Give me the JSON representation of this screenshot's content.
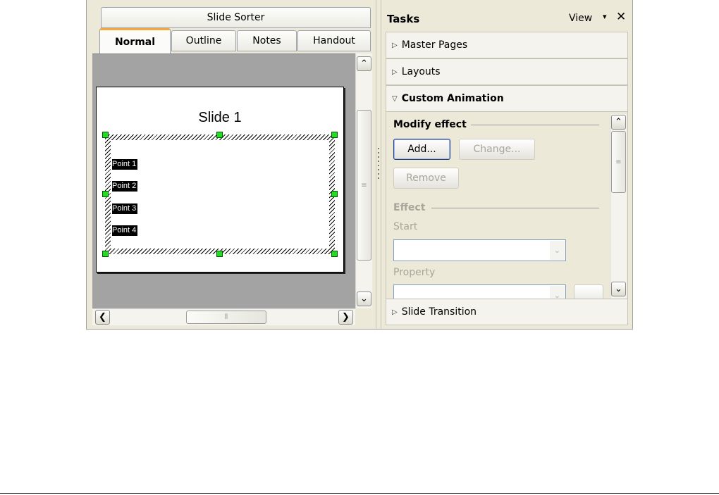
{
  "view_tabs": {
    "slide_sorter": "Slide Sorter",
    "normal": "Normal",
    "outline": "Outline",
    "notes": "Notes",
    "handout": "Handout"
  },
  "slide": {
    "title": "Slide 1",
    "bullets": [
      "Point 1",
      "Point 2",
      "Point 3",
      "Point 4"
    ]
  },
  "task_pane": {
    "title": "Tasks",
    "view_label": "View",
    "view_arrow": "▾",
    "close": "✕",
    "sections": {
      "master_pages": "Master Pages",
      "layouts": "Layouts",
      "custom_animation": "Custom Animation",
      "slide_transition": "Slide Transition"
    },
    "modify_effect": {
      "group_label": "Modify effect",
      "add": "Add...",
      "change": "Change...",
      "remove": "Remove"
    },
    "effect": {
      "group_label": "Effect",
      "start_label": "Start",
      "start_value": "",
      "property_label": "Property",
      "property_value": ""
    }
  },
  "icons": {
    "expand": "▷",
    "collapse": "▽",
    "scroll_up": "⌃",
    "scroll_down": "⌄",
    "scroll_left": "❮",
    "scroll_right": "❯",
    "combo_arrow": "⌄"
  },
  "colors": {
    "handle": "#22dd22",
    "active_tab_accent": "#f2a93a",
    "panel_bg": "#ece9d8"
  }
}
